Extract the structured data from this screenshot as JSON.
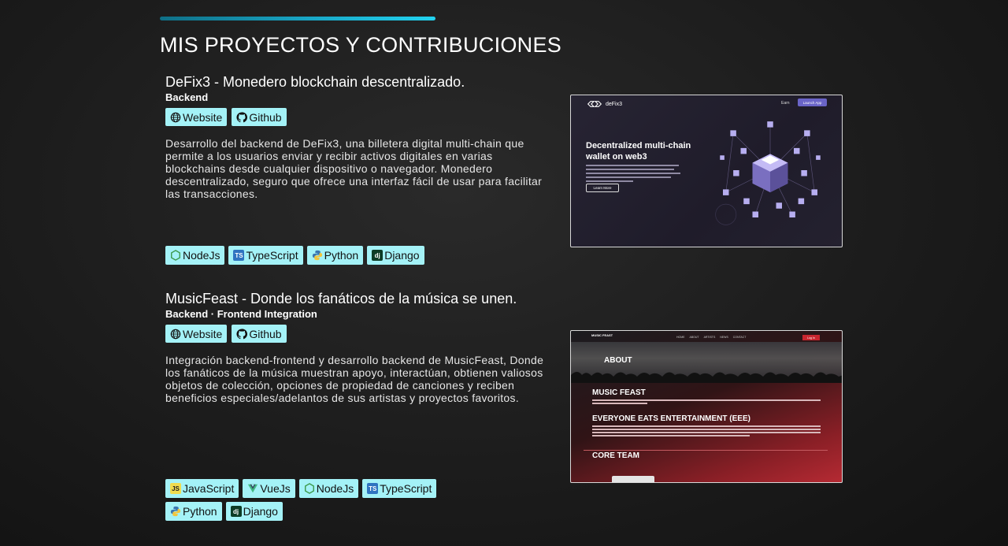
{
  "section": {
    "title": "MIS PROYECTOS Y CONTRIBUCIONES"
  },
  "colors": {
    "accent": "#22d3f0",
    "chip_bg": "#a4f2f7",
    "background": "#1c1c1c"
  },
  "projects": [
    {
      "title": "DeFix3 - Monedero blockchain descentralizado.",
      "role": "Backend",
      "links": [
        {
          "label": "Website",
          "icon": "globe-icon"
        },
        {
          "label": "Github",
          "icon": "github-icon"
        }
      ],
      "description": "Desarrollo del backend de DeFix3, una billetera digital multi-chain que permite a los usuarios enviar y recibir activos digitales en varias blockchains desde cualquier dispositivo o navegador. Monedero descentralizado, seguro que ofrece una interfaz fácil de usar para facilitar las transacciones.",
      "technologies": [
        "NodeJs",
        "TypeScript",
        "Python",
        "Django"
      ],
      "screenshot": {
        "brand": "deFix3",
        "nav_link": "Earn",
        "nav_button": "Launch App",
        "headline_1": "Decentralized multi-chain",
        "headline_2": "wallet on web3",
        "cta": "Learn More"
      }
    },
    {
      "title": "MusicFeast - Donde los fanáticos de la música se unen.",
      "role": "Backend · Frontend Integration",
      "links": [
        {
          "label": "Website",
          "icon": "globe-icon"
        },
        {
          "label": "Github",
          "icon": "github-icon"
        }
      ],
      "description": "Integración backend-frontend y desarrollo backend de MusicFeast, Donde los fanáticos de la música muestran apoyo, interactúan, obtienen valiosos objetos de colección, opciones de propiedad de canciones y reciben beneficios especiales/adelantos de sus artistas y proyectos favoritos.",
      "technologies": [
        "JavaScript",
        "VueJs",
        "NodeJs",
        "TypeScript",
        "Python",
        "Django"
      ],
      "screenshot": {
        "brand": "MUSIC FEAST",
        "nav": [
          "HOME",
          "ABOUT",
          "ARTISTS",
          "NEWS",
          "CONTACT"
        ],
        "nav_button": "Log In",
        "about": "ABOUT",
        "heading_1": "MUSIC FEAST",
        "heading_2": "EVERYONE EATS ENTERTAINMENT (EEE)",
        "heading_3": "CORE TEAM"
      }
    }
  ]
}
